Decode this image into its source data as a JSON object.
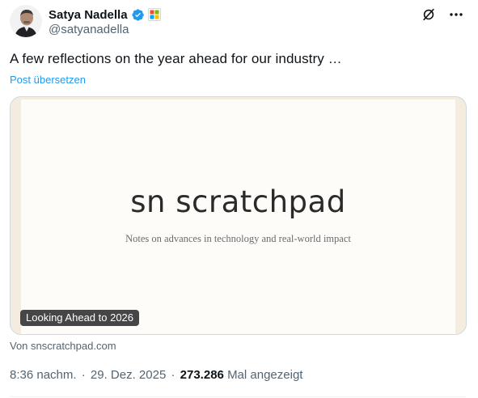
{
  "author": {
    "display_name": "Satya Nadella",
    "handle": "@satyanadella",
    "verified_icon": "verified-badge-icon",
    "affiliate_icon": "microsoft-logo-icon"
  },
  "post": {
    "text": "A few reflections on the year ahead for our industry …",
    "translate_label": "Post übersetzen"
  },
  "card": {
    "title": "sn scratchpad",
    "subtitle": "Notes on advances in technology and real-world impact",
    "label": "Looking Ahead to 2026",
    "source": "Von snscratchpad.com"
  },
  "meta": {
    "time": "8:36 nachm.",
    "date": "29. Dez. 2025",
    "views_count": "273.286",
    "views_label": "Mal angezeigt",
    "separator": "·"
  },
  "colors": {
    "verified_blue": "#1d9bf0",
    "link_blue": "#1d9bf0",
    "secondary_text": "#536471",
    "card_border": "#cfd9de",
    "card_edge": "#f5ece0",
    "card_bg": "#fdfcf9"
  }
}
